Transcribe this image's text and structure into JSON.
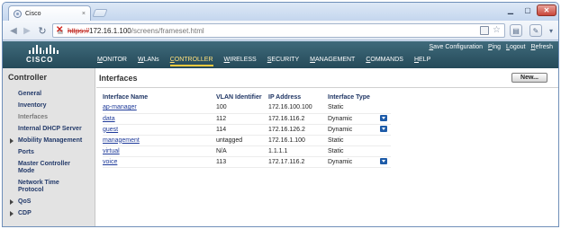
{
  "browser": {
    "tab_title": "Cisco",
    "tab_close": "×",
    "url_scheme": "https://",
    "url_host": "172.16.1.100",
    "url_path": "/screens/frameset.html"
  },
  "header": {
    "logo_text": "CISCO",
    "util_links": [
      "Save Configuration",
      "Ping",
      "Logout",
      "Refresh"
    ],
    "nav": [
      {
        "label": "MONITOR",
        "active": false
      },
      {
        "label": "WLANs",
        "active": false
      },
      {
        "label": "CONTROLLER",
        "active": true
      },
      {
        "label": "WIRELESS",
        "active": false
      },
      {
        "label": "SECURITY",
        "active": false
      },
      {
        "label": "MANAGEMENT",
        "active": false
      },
      {
        "label": "COMMANDS",
        "active": false
      },
      {
        "label": "HELP",
        "active": false
      }
    ]
  },
  "sidebar": {
    "title": "Controller",
    "items": [
      {
        "label": "General",
        "expandable": false,
        "selected": false
      },
      {
        "label": "Inventory",
        "expandable": false,
        "selected": false
      },
      {
        "label": "Interfaces",
        "expandable": false,
        "selected": true
      },
      {
        "label": "Internal DHCP Server",
        "expandable": false,
        "selected": false
      },
      {
        "label": "Mobility Management",
        "expandable": true,
        "selected": false
      },
      {
        "label": "Ports",
        "expandable": false,
        "selected": false
      },
      {
        "label": "Master Controller Mode",
        "expandable": false,
        "selected": false
      },
      {
        "label": "Network Time Protocol",
        "expandable": false,
        "selected": false
      },
      {
        "label": "QoS",
        "expandable": true,
        "selected": false
      },
      {
        "label": "CDP",
        "expandable": true,
        "selected": false
      }
    ]
  },
  "main": {
    "title": "Interfaces",
    "new_button": "New...",
    "table": {
      "headers": [
        "Interface Name",
        "VLAN Identifier",
        "IP Address",
        "Interface Type"
      ],
      "rows": [
        {
          "name": "ap-manager",
          "vlan": "100",
          "ip": "172.16.100.100",
          "type": "Static",
          "dropdown": false
        },
        {
          "name": "data",
          "vlan": "112",
          "ip": "172.16.116.2",
          "type": "Dynamic",
          "dropdown": true
        },
        {
          "name": "guest",
          "vlan": "114",
          "ip": "172.16.126.2",
          "type": "Dynamic",
          "dropdown": true
        },
        {
          "name": "management",
          "vlan": "untagged",
          "ip": "172.16.1.100",
          "type": "Static",
          "dropdown": false
        },
        {
          "name": "virtual",
          "vlan": "N/A",
          "ip": "1.1.1.1",
          "type": "Static",
          "dropdown": false
        },
        {
          "name": "voice",
          "vlan": "113",
          "ip": "172.17.116.2",
          "type": "Dynamic",
          "dropdown": true
        }
      ]
    }
  },
  "colors": {
    "header_bg": "#2f5666",
    "active_nav": "#ffcb3d",
    "sidebar_bg": "#e3e3e3",
    "link": "#1f3b9a",
    "dropdown_icon": "#1d5ba8"
  }
}
